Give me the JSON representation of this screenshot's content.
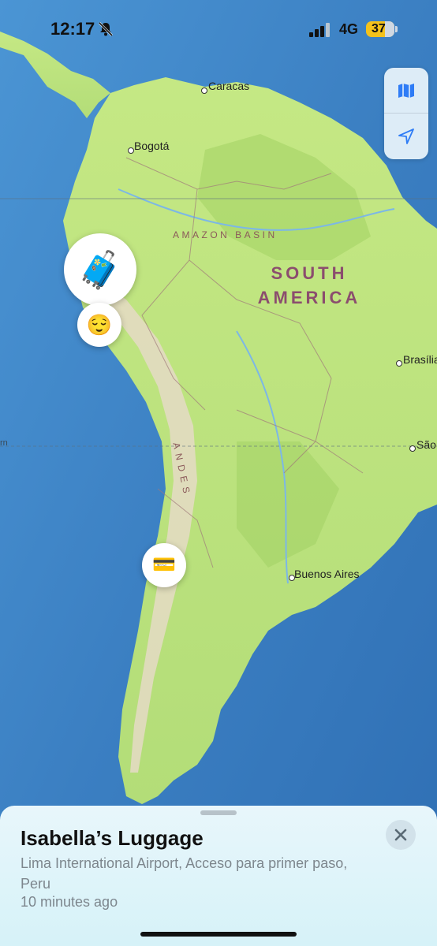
{
  "status_bar": {
    "time": "12:17",
    "network": "4G",
    "battery": "37"
  },
  "map": {
    "cities": [
      "Caracas",
      "Bogotá",
      "Brasília",
      "São",
      "Buenos Aires"
    ],
    "regions": {
      "amazon": "AMAZON BASIN",
      "continent_line1": "SOUTH",
      "continent_line2": "AMERICA",
      "andes": "ANDES",
      "edge": "rn"
    }
  },
  "controls": {
    "map_icon": "map-icon",
    "location_icon": "location-arrow-icon"
  },
  "pins": [
    {
      "name": "luggage-pin",
      "emoji": "🧳"
    },
    {
      "name": "person-pin",
      "emoji": "😌"
    },
    {
      "name": "card-pin",
      "emoji": "💳"
    }
  ],
  "sheet": {
    "title": "Isabella’s Luggage",
    "address": "Lima International Airport, Acceso para primer paso, Peru",
    "updated": "10 minutes ago"
  },
  "colors": {
    "ocean": "#3d86c8",
    "land": "#b7e07a",
    "battery": "#f4c21b"
  }
}
